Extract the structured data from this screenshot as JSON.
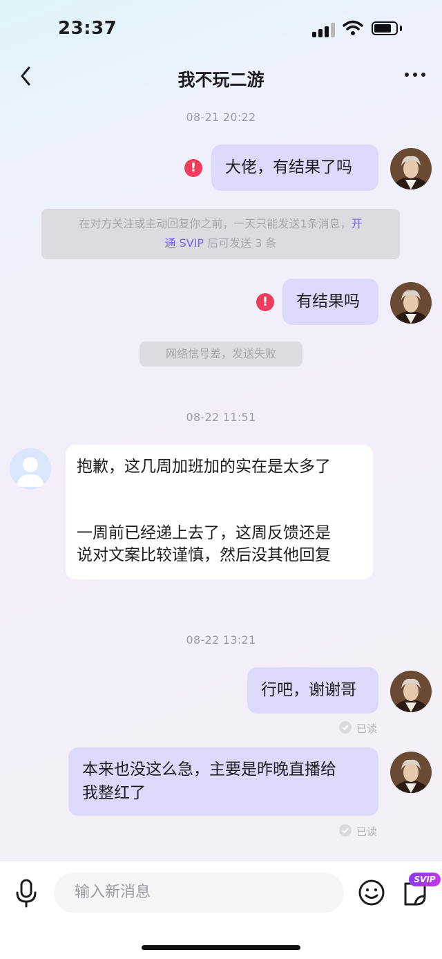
{
  "status_bar": {
    "time": "23:37"
  },
  "header": {
    "title": "我不玩二游"
  },
  "messages": {
    "ts1": "08-21  20:22",
    "out1": "大佬，有结果了吗",
    "limit_notice_line1": "在对方关注或主动回复你之前，一天只能发送1条消息，",
    "limit_notice_link1": "开",
    "limit_notice_link2": "通 SVIP",
    "limit_notice_line2": " 后可发送 3 条",
    "out2": "有结果吗",
    "network_notice": "网络信号差，发送失败",
    "ts2": "08-22  11:51",
    "in1_line1": "抱歉，这几周加班加的实在是太多了",
    "in1_line2": "一周前已经递上去了，这周反馈还是",
    "in1_line3": "说对文案比较谨慎，然后没其他回复",
    "ts3": "08-22  13:21",
    "out3": "行吧，谢谢哥",
    "read1": "已读",
    "out4_line1": "本来也没这么急，主要是昨晚直播给",
    "out4_line2": "我整红了",
    "read2": "已读",
    "error_mark": "!"
  },
  "input": {
    "placeholder": "输入新消息"
  },
  "badges": {
    "svip": "SVIP"
  },
  "colors": {
    "accent": "#7a66e0",
    "error": "#ee3d5c",
    "out_bubble": "#ddd9fb"
  }
}
